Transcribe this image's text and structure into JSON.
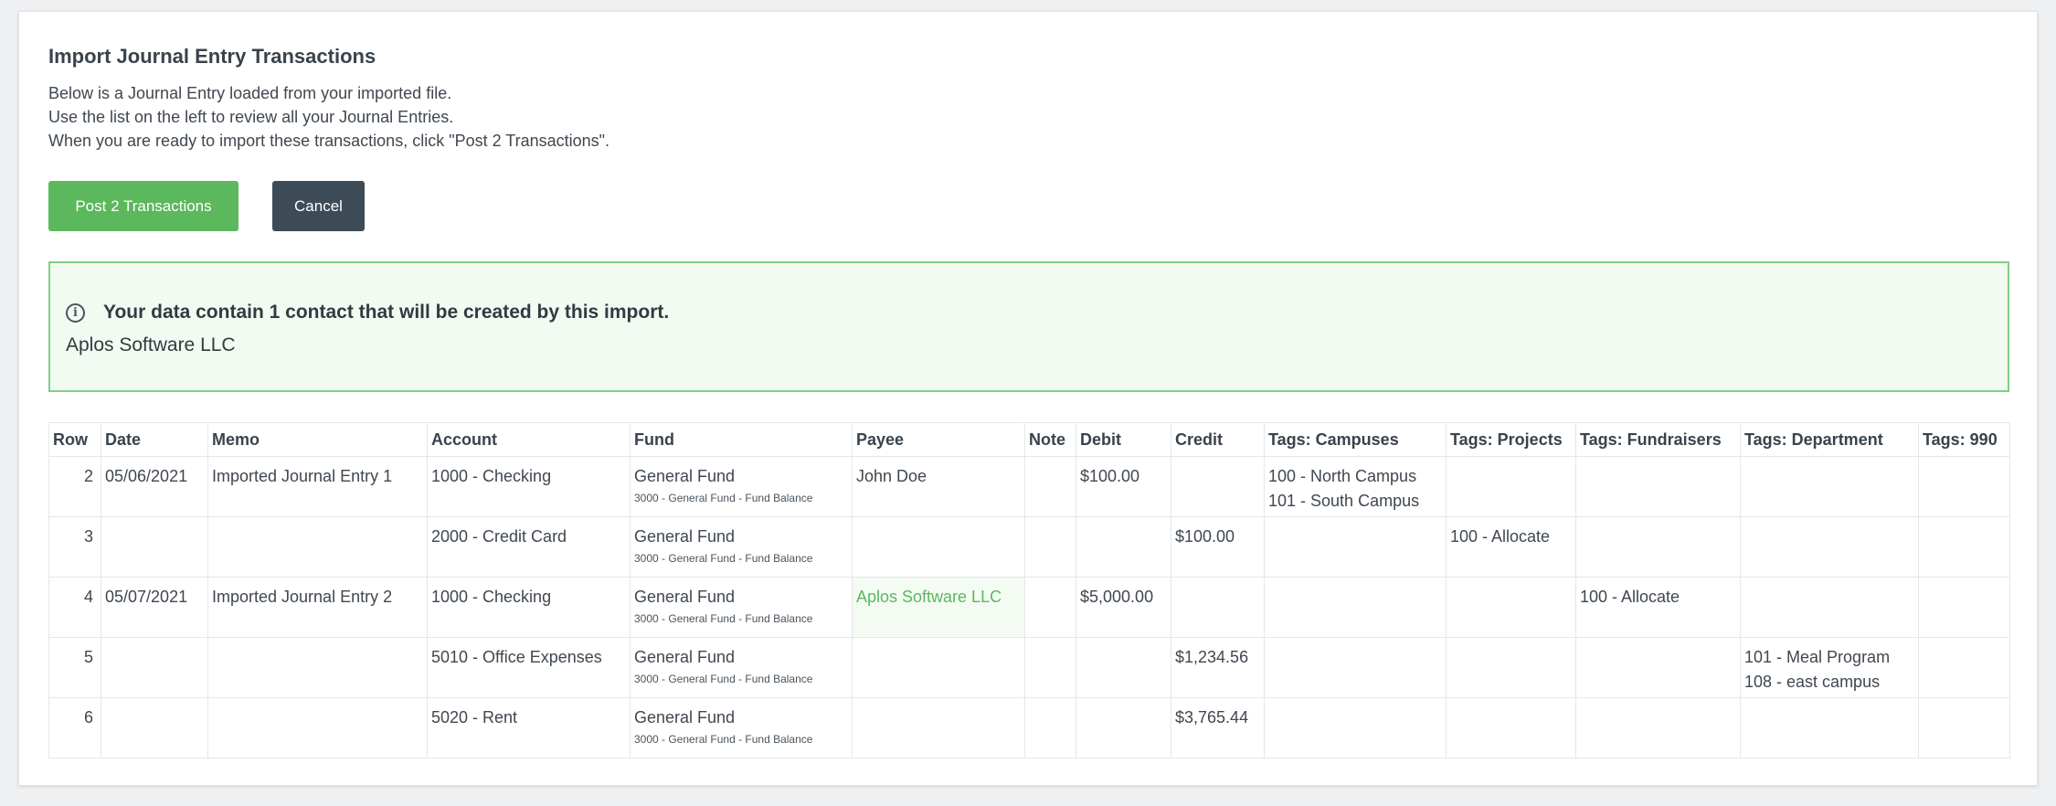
{
  "header": {
    "title": "Import Journal Entry Transactions",
    "lines": [
      "Below is a Journal Entry loaded from your imported file.",
      "Use the list on the left to review all your Journal Entries.",
      "When you are ready to import these transactions, click \"Post 2 Transactions\"."
    ]
  },
  "actions": {
    "post_label": "Post 2 Transactions",
    "cancel_label": "Cancel"
  },
  "notice": {
    "icon": "info-icon",
    "message": "Your data contain 1 contact that will be created by this import.",
    "contact": "Aplos Software LLC"
  },
  "colors": {
    "post_button": "#5cb85c",
    "cancel_button": "#3d4b56",
    "notice_border": "#7fcf83",
    "new_payee_text": "#5cb85c"
  },
  "table": {
    "columns": [
      "Row",
      "Date",
      "Memo",
      "Account",
      "Fund",
      "Payee",
      "Note",
      "Debit",
      "Credit",
      "Tags: Campuses",
      "Tags: Projects",
      "Tags: Fundraisers",
      "Tags: Department",
      "Tags: 990"
    ],
    "rows": [
      {
        "row": "2",
        "date": "05/06/2021",
        "memo": "Imported Journal Entry 1",
        "account": "1000 - Checking",
        "fund": "General Fund",
        "fund_sub": "3000 - General Fund - Fund Balance",
        "payee": "John Doe",
        "note": "",
        "debit": "$100.00",
        "credit": "",
        "campuses": [
          "100 - North Campus",
          "101 - South Campus"
        ],
        "projects": "",
        "fundraisers": "",
        "department": [],
        "tags990": ""
      },
      {
        "row": "3",
        "date": "",
        "memo": "",
        "account": "2000 - Credit Card",
        "fund": "General Fund",
        "fund_sub": "3000 - General Fund - Fund Balance",
        "payee": "",
        "note": "",
        "debit": "",
        "credit": "$100.00",
        "campuses": [],
        "projects": "100 - Allocate",
        "fundraisers": "",
        "department": [],
        "tags990": ""
      },
      {
        "row": "4",
        "date": "05/07/2021",
        "memo": "Imported Journal Entry 2",
        "account": "1000 - Checking",
        "fund": "General Fund",
        "fund_sub": "3000 - General Fund - Fund Balance",
        "payee": "Aplos Software LLC",
        "note": "",
        "debit": "$5,000.00",
        "credit": "",
        "campuses": [],
        "projects": "",
        "fundraisers": "100 - Allocate",
        "department": [],
        "tags990": ""
      },
      {
        "row": "5",
        "date": "",
        "memo": "",
        "account": "5010 - Office Expenses",
        "fund": "General Fund",
        "fund_sub": "3000 - General Fund - Fund Balance",
        "payee": "",
        "note": "",
        "debit": "",
        "credit": "$1,234.56",
        "campuses": [],
        "projects": "",
        "fundraisers": "",
        "department": [
          "101 - Meal Program",
          "108 - east campus"
        ],
        "tags990": ""
      },
      {
        "row": "6",
        "date": "",
        "memo": "",
        "account": "5020 - Rent",
        "fund": "General Fund",
        "fund_sub": "3000 - General Fund - Fund Balance",
        "payee": "",
        "note": "",
        "debit": "",
        "credit": "$3,765.44",
        "campuses": [],
        "projects": "",
        "fundraisers": "",
        "department": [],
        "tags990": ""
      }
    ]
  }
}
